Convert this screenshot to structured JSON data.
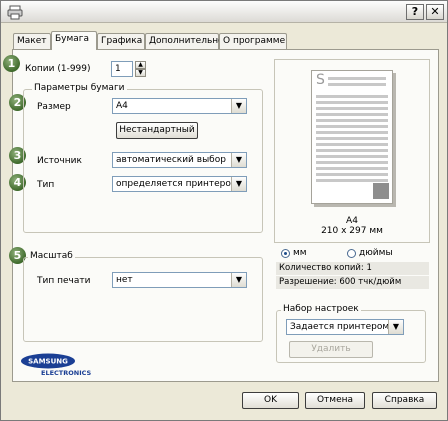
{
  "titlebar": {
    "help_label": "?",
    "close_label": "✕",
    "help_icon": "question-icon",
    "close_icon": "close-icon"
  },
  "tabs": [
    {
      "label": "Макет",
      "active": false
    },
    {
      "label": "Бумага",
      "active": true
    },
    {
      "label": "Графика",
      "active": false
    },
    {
      "label": "Дополнительно",
      "active": false
    },
    {
      "label": "О программе",
      "active": false
    }
  ],
  "badges": [
    "1",
    "2",
    "3",
    "4",
    "5"
  ],
  "copies": {
    "label": "Копии (1-999)",
    "value": "1",
    "spin_up": "▲",
    "spin_down": "▼"
  },
  "paper_options": {
    "title": "Параметры бумаги",
    "size": {
      "label": "Размер",
      "value": "A4",
      "arrow": "▼"
    },
    "custom_button": "Нестандартный",
    "source": {
      "label": "Источник",
      "value": "автоматический выбор",
      "arrow": "▼"
    },
    "type": {
      "label": "Тип",
      "value": "определяется принтером",
      "arrow": "▼"
    }
  },
  "scaling": {
    "title": "Масштаб",
    "print_type": {
      "label": "Тип печати",
      "value": "нет",
      "arrow": "▼"
    }
  },
  "preview": {
    "page_letter": "S",
    "size_name": "A4",
    "size_dims": "210 x 297 мм",
    "unit_mm": "мм",
    "unit_inch": "дюймы",
    "selected_unit": "mm",
    "copies_info": "Количество копий: 1",
    "resolution_info": "Разрешение: 600 тчк/дюйм"
  },
  "favorites": {
    "title": "Набор настроек",
    "value": "Задается принтером",
    "arrow": "▼",
    "delete_button": "Удалить"
  },
  "logo": {
    "brand": "SAMSUNG",
    "sub": "ELECTRONICS"
  },
  "footer": {
    "ok": "OK",
    "cancel": "Отмена",
    "help": "Справка"
  },
  "colors": {
    "accent_badge": "#4f7a3a",
    "window_bg": "#ece9d8",
    "panel_bg": "#fbfbf8",
    "logo_blue": "#1b3f94"
  }
}
